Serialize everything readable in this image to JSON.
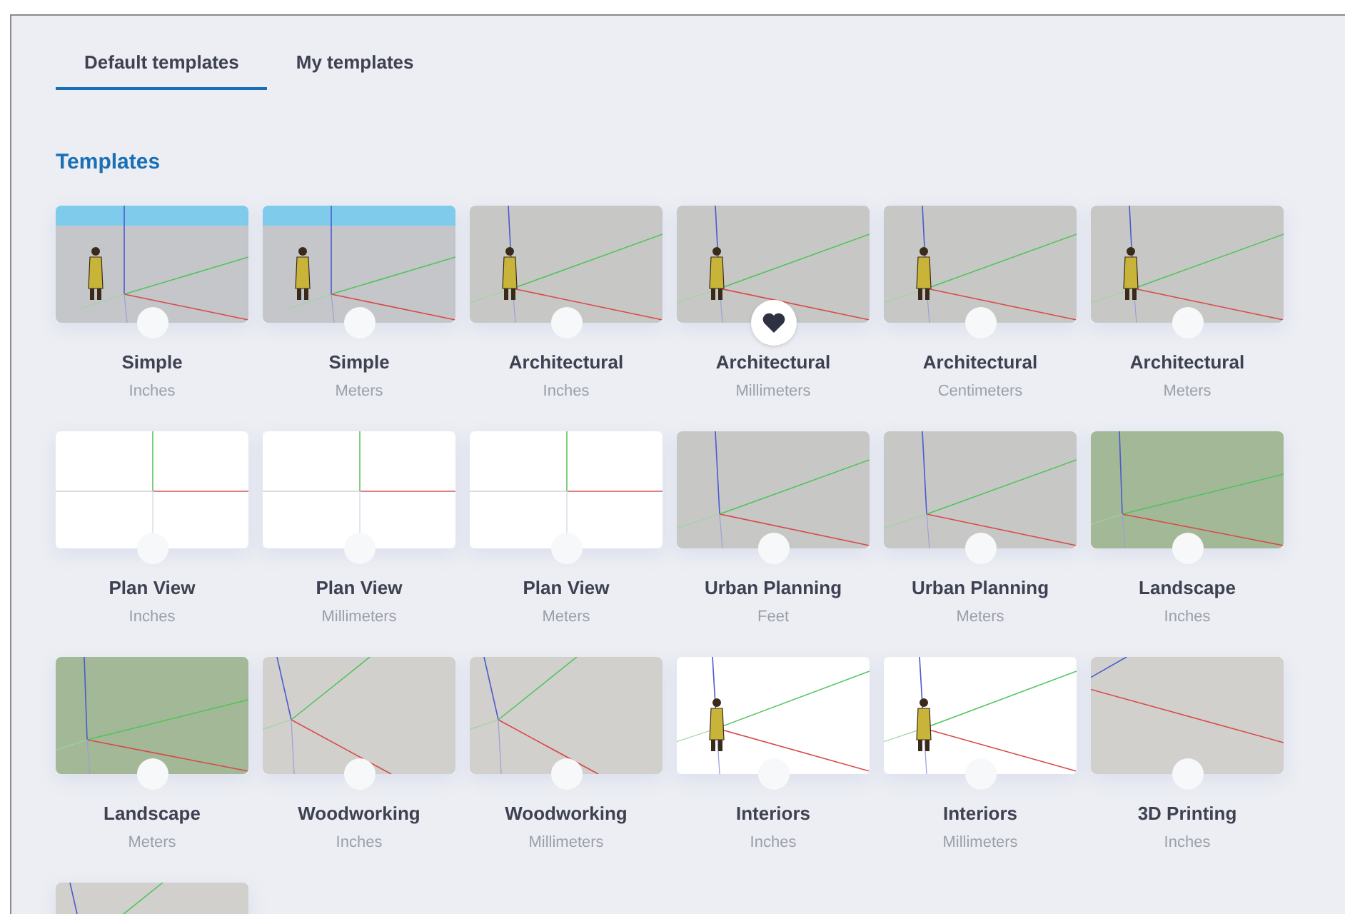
{
  "tabs": [
    {
      "label": "Default templates",
      "selected": true
    },
    {
      "label": "My templates",
      "selected": false
    }
  ],
  "section_title": "Templates",
  "templates": [
    {
      "name": "Simple",
      "unit": "Inches",
      "kind": "sky",
      "figure": true,
      "favorite": false
    },
    {
      "name": "Simple",
      "unit": "Meters",
      "kind": "sky",
      "figure": true,
      "favorite": false
    },
    {
      "name": "Architectural",
      "unit": "Inches",
      "kind": "gray",
      "figure": true,
      "favorite": false
    },
    {
      "name": "Architectural",
      "unit": "Millimeters",
      "kind": "gray",
      "figure": true,
      "favorite": true
    },
    {
      "name": "Architectural",
      "unit": "Centimeters",
      "kind": "gray",
      "figure": true,
      "favorite": false
    },
    {
      "name": "Architectural",
      "unit": "Meters",
      "kind": "gray",
      "figure": true,
      "favorite": false
    },
    {
      "name": "Plan View",
      "unit": "Inches",
      "kind": "plan",
      "figure": false,
      "favorite": false
    },
    {
      "name": "Plan View",
      "unit": "Millimeters",
      "kind": "plan",
      "figure": false,
      "favorite": false
    },
    {
      "name": "Plan View",
      "unit": "Meters",
      "kind": "plan",
      "figure": false,
      "favorite": false
    },
    {
      "name": "Urban Planning",
      "unit": "Feet",
      "kind": "gray",
      "figure": false,
      "favorite": false
    },
    {
      "name": "Urban Planning",
      "unit": "Meters",
      "kind": "gray",
      "figure": false,
      "favorite": false
    },
    {
      "name": "Landscape",
      "unit": "Inches",
      "kind": "green",
      "figure": false,
      "favorite": false
    },
    {
      "name": "Landscape",
      "unit": "Meters",
      "kind": "green",
      "figure": false,
      "favorite": false
    },
    {
      "name": "Woodworking",
      "unit": "Inches",
      "kind": "beige",
      "figure": false,
      "favorite": false
    },
    {
      "name": "Woodworking",
      "unit": "Millimeters",
      "kind": "beige",
      "figure": false,
      "favorite": false
    },
    {
      "name": "Interiors",
      "unit": "Inches",
      "kind": "white",
      "figure": true,
      "favorite": false
    },
    {
      "name": "Interiors",
      "unit": "Millimeters",
      "kind": "white",
      "figure": true,
      "favorite": false
    },
    {
      "name": "3D Printing",
      "unit": "Inches",
      "kind": "print",
      "figure": false,
      "favorite": false
    },
    {
      "kind": "beige"
    }
  ]
}
